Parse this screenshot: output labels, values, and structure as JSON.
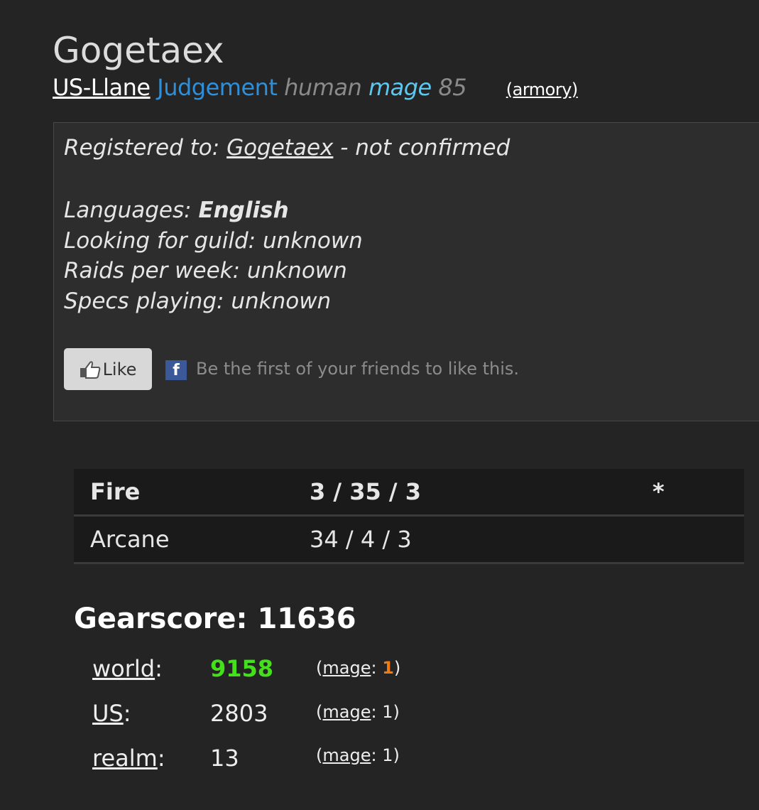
{
  "character": {
    "name": "Gogetaex",
    "realm": "US-Llane",
    "guild": "Judgement",
    "race": "human",
    "class": "mage",
    "level": "85",
    "armory_link": "(armory)"
  },
  "info": {
    "registered_prefix": "Registered to: ",
    "registered_user": "Gogetaex",
    "registered_suffix": " - not confirmed",
    "languages_label": "Languages: ",
    "languages_value": "English",
    "looking_for_guild": "Looking for guild: unknown",
    "raids_per_week": "Raids per week: unknown",
    "specs_playing": "Specs playing: unknown",
    "like_button": "Like",
    "like_text": "Be the first of your friends to like this."
  },
  "specs": [
    {
      "name": "Fire",
      "points": "3 / 35 / 3",
      "marker": "*"
    },
    {
      "name": "Arcane",
      "points": "34 / 4 / 3",
      "marker": ""
    }
  ],
  "gearscore": {
    "title": "Gearscore: 11636",
    "rankings": [
      {
        "label": "world",
        "value": "9158",
        "class": "mage",
        "class_rank": "1"
      },
      {
        "label": "US",
        "value": "2803",
        "class": "mage",
        "class_rank": "1"
      },
      {
        "label": "realm",
        "value": "13",
        "class": "mage",
        "class_rank": "1"
      }
    ]
  },
  "colors": {
    "background": "#242424",
    "guild": "#2f8fd8",
    "class": "#5cc8f0",
    "top_rank": "#44e01c",
    "class_rank_top": "#f07a10"
  }
}
